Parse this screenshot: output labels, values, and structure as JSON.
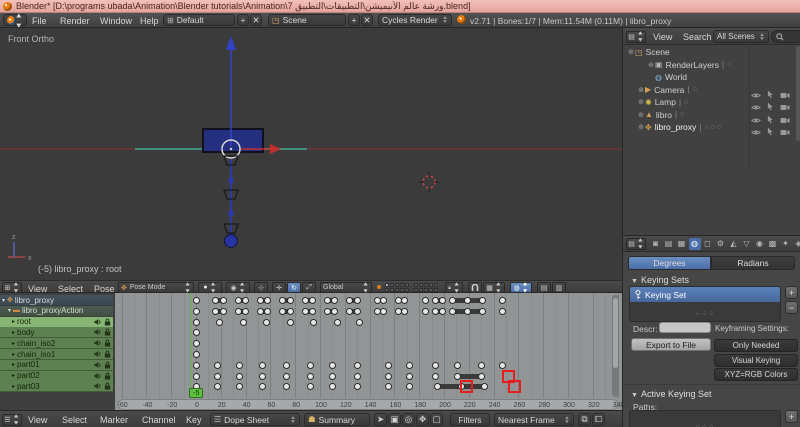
{
  "title_bar": {
    "title": "Blender* [D:\\programs ubada\\Animation\\Blender tutorials\\Animation\\7 ورشة عالم الأنيميشن\\التطبيقات\\التطبيق.blend]"
  },
  "top_header": {
    "menus": [
      "File",
      "Render",
      "Window",
      "Help"
    ],
    "layout_name": "Default",
    "scene_name": "Scene",
    "engine": "Cycles Render",
    "stats": "v2.71 | Bones:1/7 | Mem:11.54M (0.11M) | libro_proxy"
  },
  "viewport": {
    "view_label": "Front Ortho",
    "frame_info": "(-5) libro_proxy : root",
    "header": {
      "menus": [
        "View",
        "Select",
        "Pose"
      ],
      "mode": "Pose Mode",
      "orientation": "Global"
    }
  },
  "outliner": {
    "menus": [
      "View",
      "Search"
    ],
    "filter": "All Scenes",
    "rows": [
      {
        "label": "Scene",
        "indent": 0,
        "icon": "scene-icon",
        "expand": true,
        "suffix": 0,
        "restrict": false
      },
      {
        "label": "RenderLayers",
        "indent": 2,
        "icon": "renderlayers-icon",
        "expand": true,
        "suffix": 1,
        "restrict": false
      },
      {
        "label": "World",
        "indent": 2,
        "icon": "world-icon",
        "expand": false,
        "suffix": 0,
        "restrict": false
      },
      {
        "label": "Camera",
        "indent": 1,
        "icon": "camera-data-icon",
        "expand": true,
        "suffix": 1,
        "restrict": true
      },
      {
        "label": "Lamp",
        "indent": 1,
        "icon": "lamp-icon",
        "expand": true,
        "suffix": 1,
        "restrict": true
      },
      {
        "label": "libro",
        "indent": 1,
        "icon": "mesh-icon",
        "expand": true,
        "suffix": 1,
        "restrict": true
      },
      {
        "label": "libro_proxy",
        "indent": 1,
        "icon": "armature-icon",
        "expand": true,
        "suffix": 3,
        "restrict": true
      }
    ]
  },
  "properties": {
    "units": {
      "degrees": "Degrees",
      "radians": "Radians",
      "active": "Degrees"
    },
    "keying_sets": {
      "title": "Keying Sets",
      "list_item": "Keying Set",
      "descr_label": "Descr:",
      "export_button": "Export to File",
      "settings_label": "Keyframing Settings:",
      "options": [
        "Only Needed",
        "Visual Keying",
        "XYZ=RGB Colors"
      ]
    },
    "active_keying_set": {
      "title": "Active Keying Set",
      "paths_label": "Paths:"
    }
  },
  "dopesheet": {
    "header": {
      "menus": [
        "View",
        "Select",
        "Marker",
        "Channel",
        "Key"
      ],
      "editor": "Dope Sheet",
      "summary": "Summary",
      "filters_button": "Filters",
      "snap": "Nearest Frame"
    },
    "current_frame": -5,
    "ruler": {
      "start": -60,
      "end": 340,
      "step": 20
    },
    "channels": [
      {
        "label": "libro_proxy",
        "kind": "object"
      },
      {
        "label": "libro_proxyAction",
        "kind": "action"
      },
      {
        "label": "root",
        "kind": "bone",
        "selected": true
      },
      {
        "label": "body",
        "kind": "bone"
      },
      {
        "label": "chain_iso2",
        "kind": "bone"
      },
      {
        "label": "chain_iso1",
        "kind": "bone"
      },
      {
        "label": "part01",
        "kind": "bone"
      },
      {
        "label": "part02",
        "kind": "bone"
      },
      {
        "label": "part03",
        "kind": "bone"
      }
    ],
    "keys": {
      "libro_proxy": [
        0,
        16,
        22,
        34,
        40,
        52,
        58,
        70,
        76,
        88,
        94,
        106,
        112,
        124,
        130,
        146,
        151,
        163,
        168,
        185,
        193,
        199,
        207,
        219,
        231,
        247
      ],
      "libro_proxyAction": [
        0,
        16,
        22,
        34,
        40,
        52,
        58,
        70,
        76,
        88,
        94,
        106,
        112,
        124,
        130,
        146,
        151,
        163,
        168,
        185,
        193,
        199,
        207,
        219,
        231,
        247
      ],
      "root": [
        0,
        19,
        38,
        57,
        76,
        95,
        114,
        132
      ],
      "body": [
        0
      ],
      "chain_iso2": [
        0
      ],
      "chain_iso1": [
        0
      ],
      "part01": [
        0,
        17,
        35,
        54,
        73,
        92,
        110,
        130,
        155,
        172,
        193,
        211,
        230,
        247
      ],
      "part02": [
        0,
        17,
        35,
        54,
        73,
        92,
        110,
        130,
        155,
        172,
        193,
        211,
        230
      ],
      "part03": [
        0,
        17,
        35,
        54,
        73,
        92,
        110,
        130,
        155,
        172,
        195,
        214,
        233
      ]
    },
    "holds": {
      "libro_proxy": [
        [
          16,
          22
        ],
        [
          34,
          40
        ],
        [
          52,
          58
        ],
        [
          70,
          76
        ],
        [
          88,
          94
        ],
        [
          106,
          112
        ],
        [
          124,
          130
        ],
        [
          193,
          199
        ],
        [
          207,
          231
        ]
      ],
      "libro_proxyAction": [
        [
          16,
          22
        ],
        [
          34,
          40
        ],
        [
          52,
          58
        ],
        [
          70,
          76
        ],
        [
          88,
          94
        ],
        [
          106,
          112
        ],
        [
          124,
          130
        ],
        [
          193,
          199
        ],
        [
          207,
          231
        ]
      ],
      "part02": [
        [
          211,
          230
        ]
      ],
      "part03": [
        [
          195,
          233
        ]
      ]
    },
    "highlights": [
      {
        "channel": "part02",
        "frame": 252
      },
      {
        "channel": "part03",
        "frame": 218
      },
      {
        "channel": "part03",
        "frame": 257
      }
    ]
  },
  "colors": {
    "accent_blue": "#4a6ea9",
    "channel_green": "#5d8150",
    "channel_green_selected": "#87b573",
    "keyframe_fill": "#e8e8e8",
    "highlight_red": "#e81c1c",
    "frame_marker_green": "#5bc03c",
    "axis_red_line": "#7a3535",
    "bone_teal": "#3f8f7d",
    "object_blue": "#2a3aa8",
    "titlebar_pink": "#eab2ac"
  }
}
